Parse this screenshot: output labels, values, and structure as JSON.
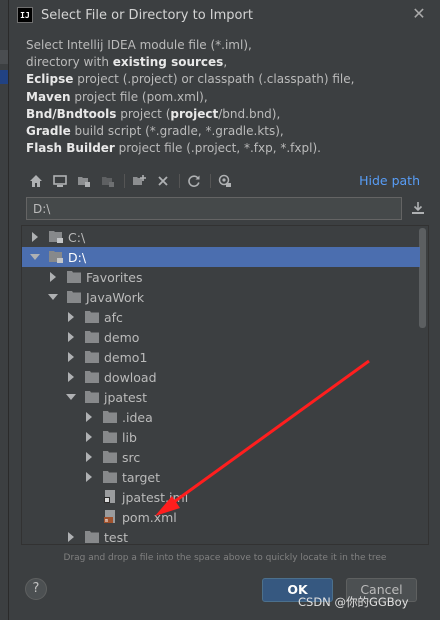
{
  "dialog": {
    "title": "Select File or Directory to Import",
    "app_icon_text": "IJ",
    "description": [
      {
        "parts": [
          {
            "t": "Select Intellij IDEA module file (*.iml),",
            "b": false
          }
        ]
      },
      {
        "parts": [
          {
            "t": "directory with ",
            "b": false
          },
          {
            "t": "existing sources",
            "b": true
          },
          {
            "t": ",",
            "b": false
          }
        ]
      },
      {
        "parts": [
          {
            "t": "Eclipse",
            "b": true
          },
          {
            "t": " project (.project) or classpath (.classpath) file,",
            "b": false
          }
        ]
      },
      {
        "parts": [
          {
            "t": "Maven",
            "b": true
          },
          {
            "t": " project file (pom.xml),",
            "b": false
          }
        ]
      },
      {
        "parts": [
          {
            "t": "Bnd/Bndtools",
            "b": true
          },
          {
            "t": " project (",
            "b": false
          },
          {
            "t": "project",
            "b": true
          },
          {
            "t": "/bnd.bnd),",
            "b": false
          }
        ]
      },
      {
        "parts": [
          {
            "t": "Gradle",
            "b": true
          },
          {
            "t": " build script (*.gradle, *.gradle.kts),",
            "b": false
          }
        ]
      },
      {
        "parts": [
          {
            "t": "Flash Builder",
            "b": true
          },
          {
            "t": " project file (.project, *.fxp, *.fxpl).",
            "b": false
          }
        ]
      }
    ]
  },
  "toolbar": {
    "hide_path_label": "Hide path",
    "icons": [
      "home-icon",
      "desktop-icon",
      "project-folder-icon",
      "module-folder-icon",
      "new-folder-icon",
      "delete-icon",
      "refresh-icon",
      "show-hidden-icon"
    ]
  },
  "path": {
    "value": "D:\\"
  },
  "tree": {
    "items": [
      {
        "label": "C:\\",
        "depth": 0,
        "arrow": "right",
        "icon": "drive",
        "selected": false
      },
      {
        "label": "D:\\",
        "depth": 0,
        "arrow": "down",
        "icon": "drive",
        "selected": true
      },
      {
        "label": "Favorites",
        "depth": 1,
        "arrow": "right",
        "icon": "folder",
        "selected": false
      },
      {
        "label": "JavaWork",
        "depth": 1,
        "arrow": "down",
        "icon": "folder",
        "selected": false
      },
      {
        "label": "afc",
        "depth": 2,
        "arrow": "right",
        "icon": "folder",
        "selected": false
      },
      {
        "label": "demo",
        "depth": 2,
        "arrow": "right",
        "icon": "folder",
        "selected": false
      },
      {
        "label": "demo1",
        "depth": 2,
        "arrow": "right",
        "icon": "folder",
        "selected": false
      },
      {
        "label": "dowload",
        "depth": 2,
        "arrow": "right",
        "icon": "folder",
        "selected": false
      },
      {
        "label": "jpatest",
        "depth": 2,
        "arrow": "down",
        "icon": "folder",
        "selected": false
      },
      {
        "label": ".idea",
        "depth": 3,
        "arrow": "right",
        "icon": "folder",
        "selected": false
      },
      {
        "label": "lib",
        "depth": 3,
        "arrow": "right",
        "icon": "folder",
        "selected": false
      },
      {
        "label": "src",
        "depth": 3,
        "arrow": "right",
        "icon": "folder",
        "selected": false
      },
      {
        "label": "target",
        "depth": 3,
        "arrow": "right",
        "icon": "folder",
        "selected": false
      },
      {
        "label": "jpatest.iml",
        "depth": 3,
        "arrow": "none",
        "icon": "iml-file",
        "selected": false
      },
      {
        "label": "pom.xml",
        "depth": 3,
        "arrow": "none",
        "icon": "xml-file",
        "selected": false
      },
      {
        "label": "test",
        "depth": 2,
        "arrow": "right",
        "icon": "folder",
        "selected": false
      }
    ]
  },
  "hint": "Drag and drop a file into the space above to quickly locate it in the tree",
  "buttons": {
    "help": "?",
    "ok": "OK",
    "cancel": "Cancel"
  },
  "watermark": "CSDN @你的GGBoy",
  "colors": {
    "selection": "#4b6eaf",
    "link": "#589df6",
    "ok_button": "#365880",
    "annotation_arrow": "#ff1e1e"
  }
}
